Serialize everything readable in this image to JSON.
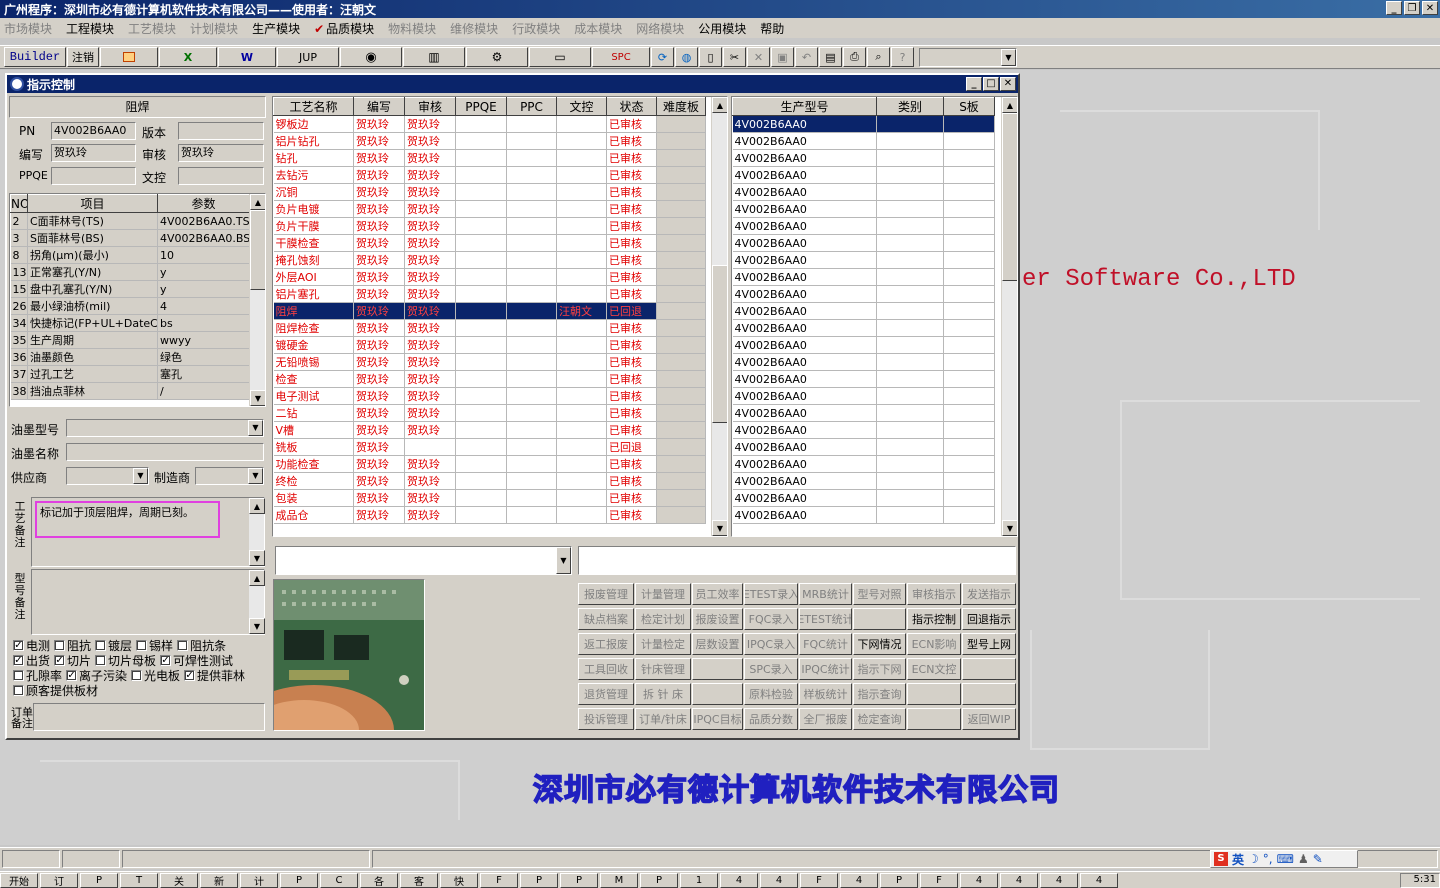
{
  "app_title": "广州程序：深圳市必有德计算机软件技术有限公司——使用者：汪朝文",
  "menu": [
    {
      "label": "市场模块",
      "disabled": true
    },
    {
      "label": "工程模块",
      "disabled": false
    },
    {
      "label": "工艺模块",
      "disabled": true
    },
    {
      "label": "计划模块",
      "disabled": true
    },
    {
      "label": "生产模块",
      "disabled": false
    },
    {
      "label": "品质模块",
      "disabled": false,
      "checked": true
    },
    {
      "label": "物料模块",
      "disabled": true
    },
    {
      "label": "维修模块",
      "disabled": true
    },
    {
      "label": "行政模块",
      "disabled": true
    },
    {
      "label": "成本模块",
      "disabled": true
    },
    {
      "label": "网络模块",
      "disabled": true
    },
    {
      "label": "公用模块",
      "disabled": false
    },
    {
      "label": "帮助",
      "disabled": false
    }
  ],
  "toolbar": {
    "builder": "Builder",
    "logout": "注销",
    "jup": "JUP",
    "spc": "SPC",
    "icons": [
      "office-icon",
      "excel-icon",
      "word-icon",
      "jup-icon",
      "eye-icon",
      "database-icon",
      "network-icon",
      "computer-icon",
      "spc-icon",
      "refresh-icon",
      "globe-icon",
      "new-icon",
      "cut-icon",
      "delete-icon",
      "save-icon",
      "undo-icon",
      "preview-icon",
      "print-icon",
      "find-icon",
      "help-icon"
    ]
  },
  "window": {
    "title": "指示控制",
    "left": {
      "section": "阻焊",
      "pn_label": "PN",
      "pn": "4V002B6AA0",
      "version_label": "版本",
      "version": "",
      "author_label": "编写",
      "author": "贺玖玲",
      "reviewer_label": "审核",
      "reviewer": "贺玖玲",
      "ppqe_label": "PPQE",
      "ppqe": "",
      "doc_label": "文控",
      "doc": "",
      "params_headers": [
        "NO",
        "项目",
        "参数"
      ],
      "params": [
        [
          "2",
          "C面菲林号(TS)",
          "4V002B6AA0.TS"
        ],
        [
          "3",
          "S面菲林号(BS)",
          "4V002B6AA0.BS"
        ],
        [
          "8",
          "拐角(μm)(最小)",
          "10"
        ],
        [
          "13",
          "正常塞孔(Y/N)",
          "y"
        ],
        [
          "15",
          "盘中孔塞孔(Y/N)",
          "y"
        ],
        [
          "26",
          "最小绿油桥(mil)",
          "4"
        ],
        [
          "34",
          "快捷标记(FP+UL+DateCo",
          "bs"
        ],
        [
          "35",
          "生产周期",
          "wwyy"
        ],
        [
          "36",
          "油墨颜色",
          "绿色"
        ],
        [
          "37",
          "过孔工艺",
          "塞孔"
        ],
        [
          "38",
          "挡油点菲林",
          "/"
        ]
      ],
      "ink_type_label": "油墨型号",
      "ink_name_label": "油墨名称",
      "supplier_label": "供应商",
      "maker_label": "制造商",
      "process_note_label": "工艺备注",
      "process_note": "标记加于顶层阻焊，周期已刻。",
      "model_note_label": "型号备注",
      "checks": [
        [
          {
            "label": "电测",
            "checked": true
          },
          {
            "label": "阻抗",
            "checked": false
          },
          {
            "label": "镀层",
            "checked": false
          },
          {
            "label": "锡样",
            "checked": false
          },
          {
            "label": "阻抗条",
            "checked": false
          }
        ],
        [
          {
            "label": "出货",
            "checked": true
          },
          {
            "label": "切片",
            "checked": true
          },
          {
            "label": "切片母板",
            "checked": false
          },
          {
            "label": "可焊性测试",
            "checked": true
          }
        ],
        [
          {
            "label": "孔隙率",
            "checked": false
          },
          {
            "label": "离子污染",
            "checked": true
          },
          {
            "label": "光电板",
            "checked": false
          },
          {
            "label": "提供菲林",
            "checked": true
          }
        ],
        [
          {
            "label": "顾客提供板材",
            "checked": false
          }
        ]
      ],
      "order_note_label": "订单备注"
    },
    "process_headers": [
      "工艺名称",
      "编写",
      "审核",
      "PPQE",
      "PPC",
      "文控",
      "状态",
      "难度板"
    ],
    "process_rows": [
      [
        "锣板边",
        "贺玖玲",
        "贺玖玲",
        "",
        "",
        "",
        "已审核",
        ""
      ],
      [
        "铝片钻孔",
        "贺玖玲",
        "贺玖玲",
        "",
        "",
        "",
        "已审核",
        ""
      ],
      [
        "钻孔",
        "贺玖玲",
        "贺玖玲",
        "",
        "",
        "",
        "已审核",
        ""
      ],
      [
        "去钻污",
        "贺玖玲",
        "贺玖玲",
        "",
        "",
        "",
        "已审核",
        ""
      ],
      [
        "沉铜",
        "贺玖玲",
        "贺玖玲",
        "",
        "",
        "",
        "已审核",
        ""
      ],
      [
        "负片电镀",
        "贺玖玲",
        "贺玖玲",
        "",
        "",
        "",
        "已审核",
        ""
      ],
      [
        "负片干膜",
        "贺玖玲",
        "贺玖玲",
        "",
        "",
        "",
        "已审核",
        ""
      ],
      [
        "干膜检查",
        "贺玖玲",
        "贺玖玲",
        "",
        "",
        "",
        "已审核",
        ""
      ],
      [
        "掩孔蚀刻",
        "贺玖玲",
        "贺玖玲",
        "",
        "",
        "",
        "已审核",
        ""
      ],
      [
        "外层AOI",
        "贺玖玲",
        "贺玖玲",
        "",
        "",
        "",
        "已审核",
        ""
      ],
      [
        "铝片塞孔",
        "贺玖玲",
        "贺玖玲",
        "",
        "",
        "",
        "已审核",
        ""
      ],
      [
        "阻焊",
        "贺玖玲",
        "贺玖玲",
        "",
        "",
        "汪朝文",
        "已回退",
        ""
      ],
      [
        "阻焊检查",
        "贺玖玲",
        "贺玖玲",
        "",
        "",
        "",
        "已审核",
        ""
      ],
      [
        "镀硬金",
        "贺玖玲",
        "贺玖玲",
        "",
        "",
        "",
        "已审核",
        ""
      ],
      [
        "无铅喷锡",
        "贺玖玲",
        "贺玖玲",
        "",
        "",
        "",
        "已审核",
        ""
      ],
      [
        "检查",
        "贺玖玲",
        "贺玖玲",
        "",
        "",
        "",
        "已审核",
        ""
      ],
      [
        "电子测试",
        "贺玖玲",
        "贺玖玲",
        "",
        "",
        "",
        "已审核",
        ""
      ],
      [
        "二钻",
        "贺玖玲",
        "贺玖玲",
        "",
        "",
        "",
        "已审核",
        ""
      ],
      [
        "V槽",
        "贺玖玲",
        "贺玖玲",
        "",
        "",
        "",
        "已审核",
        ""
      ],
      [
        "铣板",
        "贺玖玲",
        "",
        "",
        "",
        "",
        "已回退",
        ""
      ],
      [
        "功能检查",
        "贺玖玲",
        "贺玖玲",
        "",
        "",
        "",
        "已审核",
        ""
      ],
      [
        "终检",
        "贺玖玲",
        "贺玖玲",
        "",
        "",
        "",
        "已审核",
        ""
      ],
      [
        "包装",
        "贺玖玲",
        "贺玖玲",
        "",
        "",
        "",
        "已审核",
        ""
      ],
      [
        "成品仓",
        "贺玖玲",
        "贺玖玲",
        "",
        "",
        "",
        "已审核",
        ""
      ]
    ],
    "process_selected": 11,
    "model_headers": [
      "生产型号",
      "类别",
      "S板"
    ],
    "model_rows": [
      "4V002B6AA0",
      "4V002B6AA0",
      "4V002B6AA0",
      "4V002B6AA0",
      "4V002B6AA0",
      "4V002B6AA0",
      "4V002B6AA0",
      "4V002B6AA0",
      "4V002B6AA0",
      "4V002B6AA0",
      "4V002B6AA0",
      "4V002B6AA0",
      "4V002B6AA0",
      "4V002B6AA0",
      "4V002B6AA0",
      "4V002B6AA0",
      "4V002B6AA0",
      "4V002B6AA0",
      "4V002B6AA0",
      "4V002B6AA0",
      "4V002B6AA0",
      "4V002B6AA0",
      "4V002B6AA0",
      "4V002B6AA0"
    ],
    "buttons": [
      [
        {
          "l": "报废管理",
          "d": true
        },
        {
          "l": "计量管理",
          "d": true
        },
        {
          "l": "员工效率",
          "d": true
        },
        {
          "l": "ETEST录入",
          "d": true
        },
        {
          "l": "MRB统计",
          "d": true
        },
        {
          "l": "型号对照",
          "d": true
        },
        {
          "l": "审核指示",
          "d": true
        },
        {
          "l": "发送指示",
          "d": true
        }
      ],
      [
        {
          "l": "缺点档案",
          "d": true
        },
        {
          "l": "检定计划",
          "d": true
        },
        {
          "l": "报废设置",
          "d": true
        },
        {
          "l": "FQC录入",
          "d": true
        },
        {
          "l": "ETEST统计",
          "d": true
        },
        {
          "l": "",
          "d": true
        },
        {
          "l": "指示控制",
          "d": false
        },
        {
          "l": "回退指示",
          "d": false
        }
      ],
      [
        {
          "l": "返工报废",
          "d": true
        },
        {
          "l": "计量检定",
          "d": true
        },
        {
          "l": "层数设置",
          "d": true
        },
        {
          "l": "IPQC录入",
          "d": true
        },
        {
          "l": "FQC统计",
          "d": true
        },
        {
          "l": "下网情况",
          "d": false
        },
        {
          "l": "ECN影响",
          "d": true
        },
        {
          "l": "型号上网",
          "d": false
        }
      ],
      [
        {
          "l": "工具回收",
          "d": true
        },
        {
          "l": "针床管理",
          "d": true
        },
        {
          "l": "",
          "d": true
        },
        {
          "l": "SPC录入",
          "d": true
        },
        {
          "l": "IPQC统计",
          "d": true
        },
        {
          "l": "指示下网",
          "d": true
        },
        {
          "l": "ECN文控",
          "d": true
        },
        {
          "l": "",
          "d": true
        }
      ],
      [
        {
          "l": "退货管理",
          "d": true
        },
        {
          "l": "拆 针 床",
          "d": true
        },
        {
          "l": "",
          "d": true
        },
        {
          "l": "原料检验",
          "d": true
        },
        {
          "l": "样板统计",
          "d": true
        },
        {
          "l": "指示查询",
          "d": true
        },
        {
          "l": "",
          "d": true
        },
        {
          "l": "",
          "d": true
        }
      ],
      [
        {
          "l": "投诉管理",
          "d": true
        },
        {
          "l": "订单/针床",
          "d": true
        },
        {
          "l": "IPQC目标",
          "d": true
        },
        {
          "l": "品质分数",
          "d": true
        },
        {
          "l": "全厂报废",
          "d": true
        },
        {
          "l": "检定查询",
          "d": true
        },
        {
          "l": "",
          "d": true
        },
        {
          "l": "返回WIP",
          "d": true
        }
      ]
    ]
  },
  "desktop": {
    "company_cn": "深圳市必有德计算机软件技术有限公司",
    "company_en": "er Software Co.,LTD"
  },
  "tray": {
    "ime": "英",
    "clock": "5:31"
  },
  "taskbar_items": [
    "开始",
    "订",
    "P",
    "T",
    "关",
    "新",
    "计",
    "P",
    "C",
    "各",
    "客",
    "快",
    "F",
    "P",
    "P",
    "M",
    "P",
    "1",
    "4",
    "4",
    "F",
    "4",
    "P",
    "F",
    "4",
    "4",
    "4",
    "4"
  ],
  "colors": {
    "title": "#0a246a",
    "process_text": "#e00000",
    "face": "#d4d0c8",
    "desktop": "#cfcfcf"
  }
}
